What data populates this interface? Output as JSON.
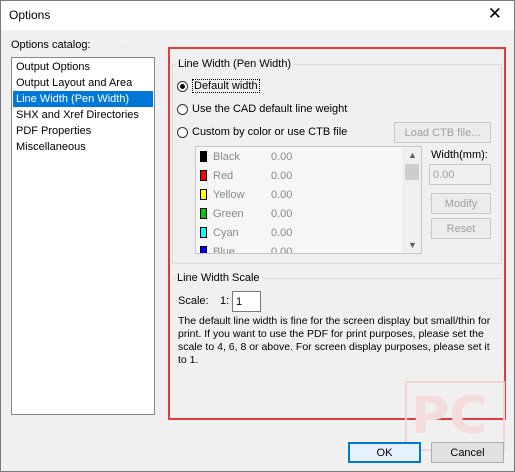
{
  "window": {
    "title": "Options",
    "close_glyph": "✕"
  },
  "catalog": {
    "label": "Options catalog:",
    "items": [
      {
        "label": "Output Options",
        "selected": false
      },
      {
        "label": "Output Layout and Area",
        "selected": false
      },
      {
        "label": "Line Width (Pen Width)",
        "selected": true
      },
      {
        "label": "SHX and Xref Directories",
        "selected": false
      },
      {
        "label": "PDF Properties",
        "selected": false
      },
      {
        "label": "Miscellaneous",
        "selected": false
      }
    ]
  },
  "line_width": {
    "group_title": "Line Width (Pen Width)",
    "options": [
      {
        "label": "Default width",
        "checked": true
      },
      {
        "label": "Use the CAD default line weight",
        "checked": false
      },
      {
        "label": "Custom by color or use CTB file",
        "checked": false
      }
    ],
    "load_ctb_label": "Load CTB file...",
    "colors": [
      {
        "name": "Black",
        "value": "0.00",
        "color": "#000000"
      },
      {
        "name": "Red",
        "value": "0.00",
        "color": "#ff0000"
      },
      {
        "name": "Yellow",
        "value": "0.00",
        "color": "#ffff00"
      },
      {
        "name": "Green",
        "value": "0.00",
        "color": "#00c800"
      },
      {
        "name": "Cyan",
        "value": "0.00",
        "color": "#00ffff"
      },
      {
        "name": "Blue",
        "value": "0.00",
        "color": "#0000ff"
      }
    ],
    "width_label": "Width(mm):",
    "width_value": "0.00",
    "modify_label": "Modify",
    "reset_label": "Reset"
  },
  "scale": {
    "group_title": "Line Width Scale",
    "label": "Scale:",
    "ratio_prefix": "1:",
    "value": "1",
    "note": "The default line width is fine for the screen display but small/thin for print. If you want to use the PDF for print purposes, please set the scale to 4, 6, 8 or above. For screen display purposes, please set it to 1."
  },
  "footer": {
    "ok_label": "OK",
    "cancel_label": "Cancel"
  },
  "watermark": {
    "text": "PC"
  },
  "colors": {
    "selection": "#0078d7",
    "highlight_box": "#e83a3a"
  },
  "icons": {
    "scroll_up": "▲",
    "scroll_down": "▼"
  }
}
